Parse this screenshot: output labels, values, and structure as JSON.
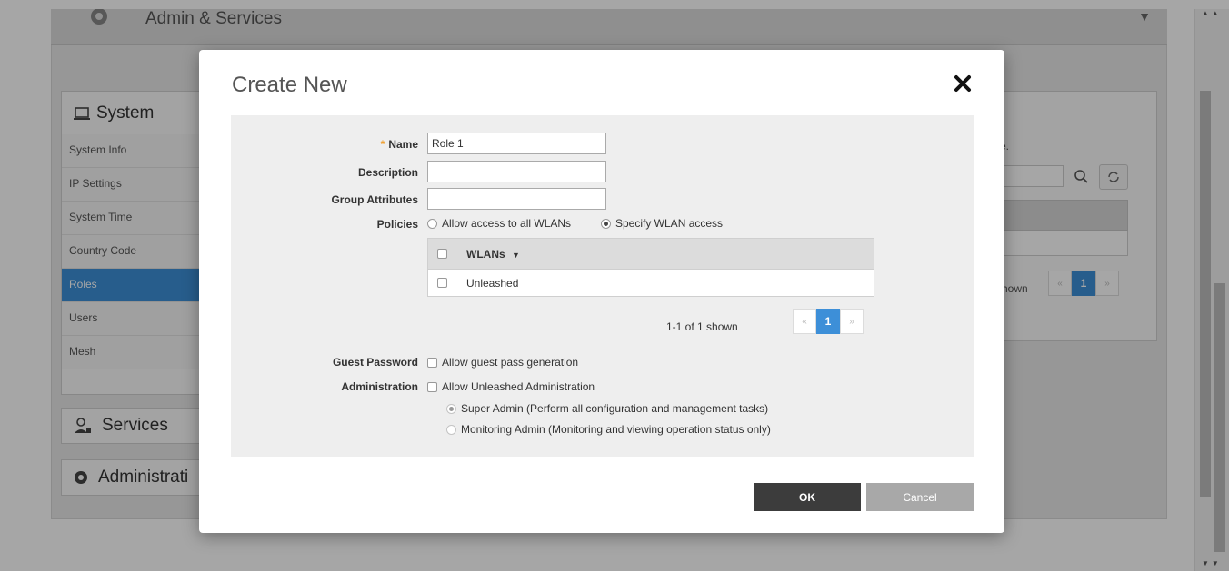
{
  "background": {
    "section_title": "Admin & Services",
    "system": {
      "title": "System",
      "items": [
        "System Info",
        "IP Settings",
        "System Time",
        "Country Code",
        "Roles",
        "Users",
        "Mesh"
      ],
      "active_item": "Roles"
    },
    "services_title": "Services",
    "administration_title": "Administrati",
    "right_panel": {
      "text_fragment": "e.",
      "shown_fragment": "hown",
      "page": "1",
      "prev": "«",
      "next": "»"
    }
  },
  "modal": {
    "title": "Create New",
    "fields": {
      "name_label": "Name",
      "name_required_mark": "*",
      "name_value": "Role 1",
      "description_label": "Description",
      "description_value": "",
      "group_attributes_label": "Group Attributes",
      "group_attributes_value": ""
    },
    "policies": {
      "label": "Policies",
      "option_all": "Allow access to all WLANs",
      "option_specify": "Specify WLAN access",
      "selected": "specify"
    },
    "wlan_table": {
      "header": "WLANs",
      "rows": [
        {
          "name": "Unleashed",
          "checked": false
        }
      ]
    },
    "pagination": {
      "summary": "1-1 of 1 shown",
      "prev": "«",
      "page": "1",
      "next": "»"
    },
    "guest_password": {
      "label": "Guest Password",
      "option": "Allow guest pass generation",
      "checked": false
    },
    "administration": {
      "label": "Administration",
      "option": "Allow Unleashed Administration",
      "checked": false,
      "sub_options": [
        "Super Admin (Perform all configuration and management tasks)",
        "Monitoring Admin (Monitoring and viewing operation status only)"
      ],
      "sub_selected": "Super Admin (Perform all configuration and management tasks)"
    },
    "buttons": {
      "ok": "OK",
      "cancel": "Cancel"
    }
  },
  "colors": {
    "accent": "#3d8fd8",
    "ok_button": "#3c3c3c",
    "cancel_button": "#a8a8a8",
    "required": "#f0a030"
  }
}
